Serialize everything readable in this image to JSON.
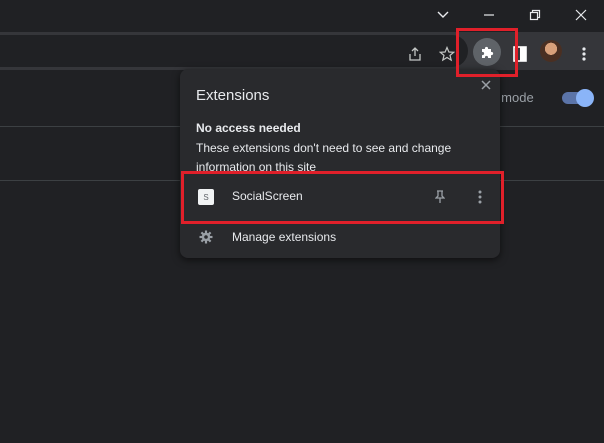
{
  "toolbar": {
    "icons": [
      "chevron-down-icon",
      "minimize-icon",
      "restore-icon",
      "close-icon",
      "share-icon",
      "star-icon",
      "extensions-icon",
      "sidepanel-icon",
      "avatar",
      "more-vert-icon"
    ]
  },
  "page": {
    "toggle_label": "er mode",
    "toggle_on": true
  },
  "popup": {
    "title": "Extensions",
    "section_heading": "No access needed",
    "section_description": "These extensions don't need to see and change information on this site",
    "extensions": [
      {
        "name": "SocialScreen",
        "favicon_letter": "S"
      }
    ],
    "manage_label": "Manage extensions"
  },
  "colors": {
    "background": "#202124",
    "toolbar": "#35363a",
    "popup": "#292a2d",
    "highlight": "#e0202a",
    "accent": "#8ab4f8"
  }
}
